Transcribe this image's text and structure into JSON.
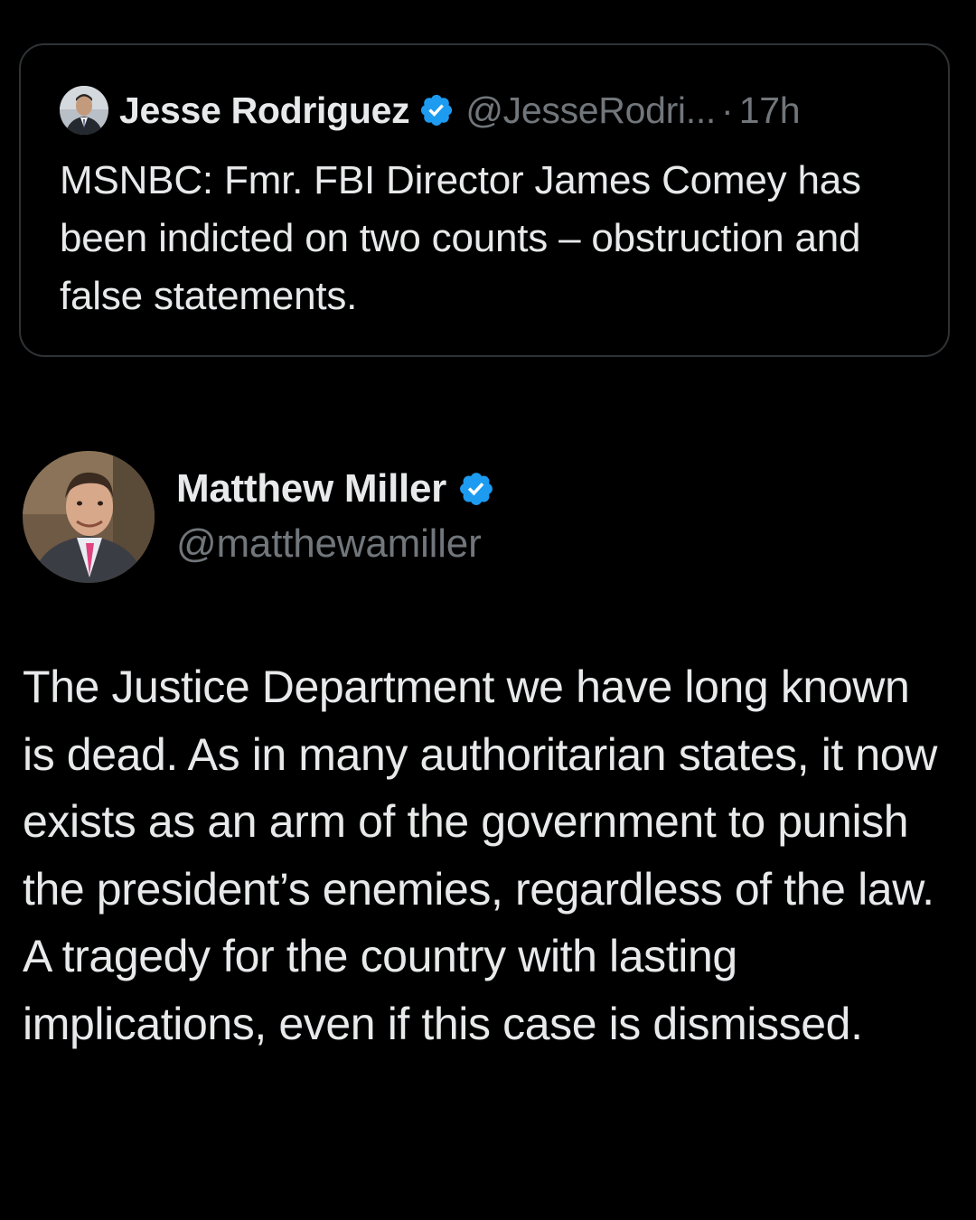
{
  "quoted_tweet": {
    "author_name": "Jesse Rodriguez",
    "handle": "@JesseRodri...",
    "separator": "·",
    "time": "17h",
    "avatar_icon": "person-avatar-icon",
    "verified_icon": "verified-badge-icon",
    "text": "MSNBC: Fmr. FBI Director James Comey has been indicted on two counts – obstruction and false statements."
  },
  "tweet": {
    "author_name": "Matthew Miller",
    "handle": "@matthewamiller",
    "avatar_icon": "person-avatar-icon",
    "verified_icon": "verified-badge-icon",
    "text": "The Justice Department we have long known is dead. As in many authoritarian states, it now exists as an arm of the government to punish the president’s enemies, regardless of the law. A tragedy for the country with lasting implications, even if this case is dismissed."
  },
  "colors": {
    "background": "#000000",
    "primary_text": "#e7e9ea",
    "secondary_text": "#71767b",
    "border": "#2f3336",
    "verified_blue": "#1d9bf0"
  }
}
